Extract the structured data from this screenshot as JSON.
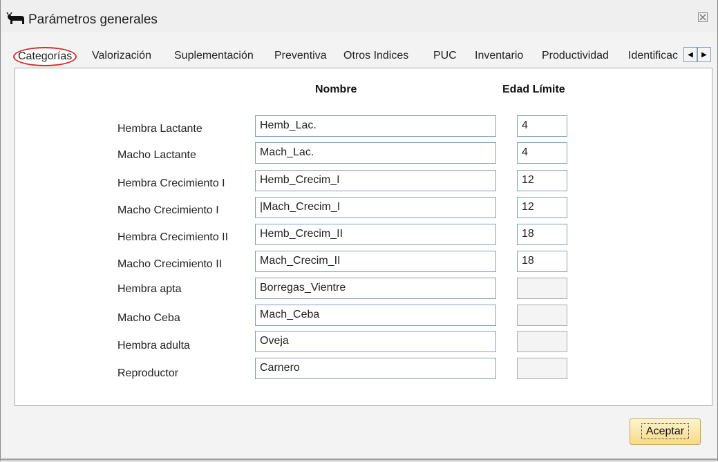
{
  "window": {
    "title": "Parámetros generales",
    "icon": "cow-icon",
    "close_icon": "close-icon"
  },
  "tabs": [
    {
      "label": "Categorías",
      "active": true
    },
    {
      "label": "Valorización",
      "active": false
    },
    {
      "label": "Suplementación",
      "active": false
    },
    {
      "label": "Preventiva",
      "active": false
    },
    {
      "label": "Otros Indices",
      "active": false
    },
    {
      "label": "PUC",
      "active": false
    },
    {
      "label": "Inventario",
      "active": false
    },
    {
      "label": "Productividad",
      "active": false
    },
    {
      "label": "Identificac",
      "active": false
    }
  ],
  "tab_scroll": {
    "left": "◀",
    "right": "▶"
  },
  "table": {
    "header_name": "Nombre",
    "header_age": "Edad Límite",
    "rows": [
      {
        "label": "Hembra Lactante",
        "name": "Hemb_Lac.",
        "age": "4"
      },
      {
        "label": "Macho Lactante",
        "name": "Mach_Lac.",
        "age": "4"
      },
      {
        "label": "Hembra Crecimiento I",
        "name": "Hemb_Crecim_I",
        "age": "12"
      },
      {
        "label": "Macho Crecimiento I",
        "name": "|Mach_Crecim_I",
        "age": "12"
      },
      {
        "label": "Hembra Crecimiento II",
        "name": "Hemb_Crecim_II",
        "age": "18"
      },
      {
        "label": "Macho Crecimiento II",
        "name": "Mach_Crecim_II",
        "age": "18"
      },
      {
        "label": "Hembra apta",
        "name": "Borregas_Vientre",
        "age": ""
      },
      {
        "label": "Macho Ceba",
        "name": "Mach_Ceba",
        "age": ""
      },
      {
        "label": "Hembra adulta",
        "name": "Oveja",
        "age": ""
      },
      {
        "label": "Reproductor",
        "name": "Carnero",
        "age": ""
      }
    ]
  },
  "buttons": {
    "accept": "Aceptar"
  },
  "colors": {
    "highlight_circle": "#d92a2a",
    "button_bg": "#f7d98a"
  }
}
